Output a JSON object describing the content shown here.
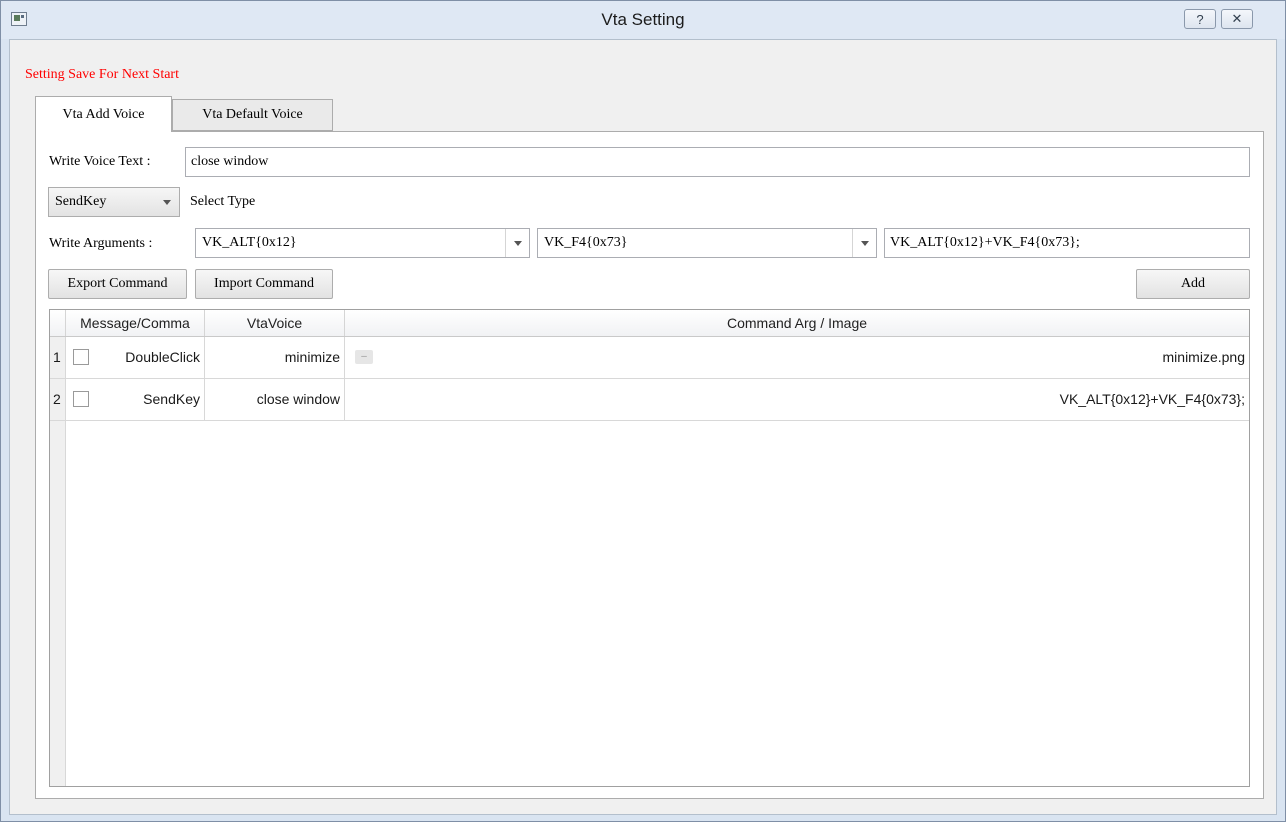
{
  "window": {
    "title": "Vta Setting",
    "help_label": "?",
    "close_label": "✕"
  },
  "notice": "Setting Save For Next Start",
  "tabs": [
    {
      "label": "Vta Add Voice",
      "active": true
    },
    {
      "label": "Vta Default Voice",
      "active": false
    }
  ],
  "form": {
    "voice_text_label": "Write Voice Text :",
    "voice_text_value": "close window",
    "type_select_value": "SendKey",
    "type_select_label": "Select Type",
    "arguments_label": "Write Arguments :",
    "arg1_value": "VK_ALT{0x12}",
    "arg2_value": "VK_F4{0x73}",
    "arg_result_value": "VK_ALT{0x12}+VK_F4{0x73};",
    "export_button": "Export Command",
    "import_button": "Import Command",
    "add_button": "Add"
  },
  "table": {
    "columns": [
      "Message/Comma",
      "VtaVoice",
      "Command Arg / Image"
    ],
    "rows": [
      {
        "num": "1",
        "message": "DoubleClick",
        "voice": "minimize",
        "arg": "minimize.png",
        "has_thumb": true
      },
      {
        "num": "2",
        "message": "SendKey",
        "voice": "close window",
        "arg": "VK_ALT{0x12}+VK_F4{0x73};",
        "has_thumb": false
      }
    ]
  },
  "colors": {
    "notice": "#ff0000",
    "titlebar": "#dfe8f4"
  }
}
